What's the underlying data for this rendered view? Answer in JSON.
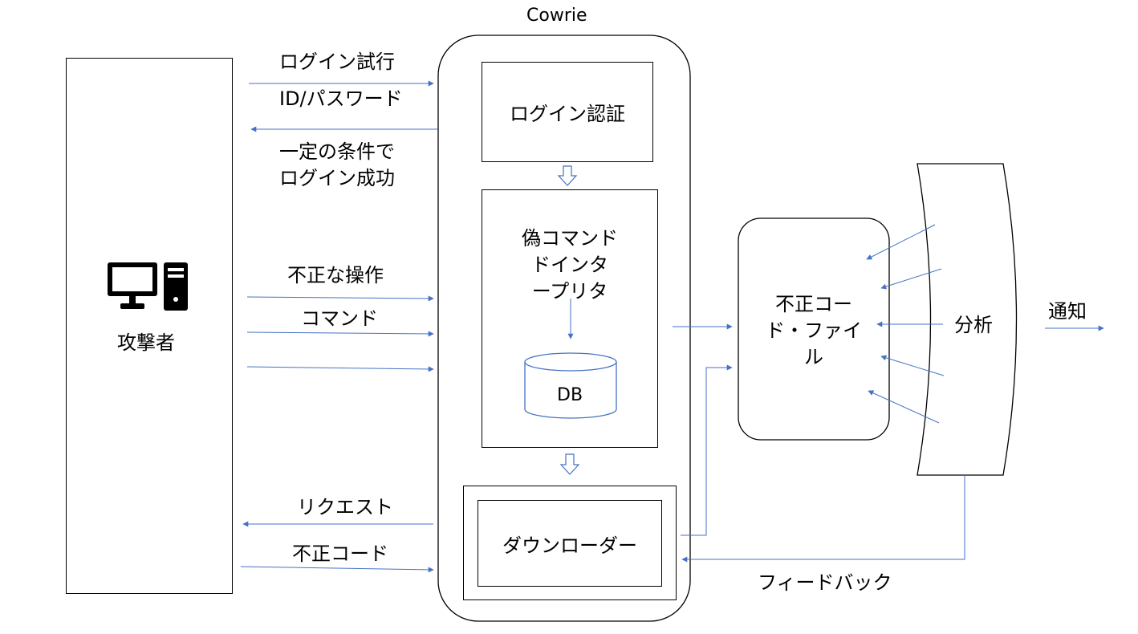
{
  "attacker": {
    "label": "攻撃者",
    "icon": "computer-icon"
  },
  "cowrie": {
    "title": "Cowrie",
    "login_auth": "ログイン認証",
    "fake_cli": "偽コマンド\nドインタ\nープリタ",
    "db": "DB",
    "downloader": "ダウンローダー"
  },
  "malicious_file": "不正コー\nド・ファイ\nル",
  "analysis": {
    "label": "分析",
    "notify": "通知"
  },
  "edges": {
    "login_attempt": "ログイン試行",
    "id_password": "ID/パスワード",
    "login_success": "一定の条件で\nログイン成功",
    "illegal_ops": "不正な操作",
    "command": "コマンド",
    "request": "リクエスト",
    "malicious_code": "不正コード",
    "feedback": "フィードバック"
  },
  "colors": {
    "arrow": "#4472c4",
    "border": "#000000"
  }
}
